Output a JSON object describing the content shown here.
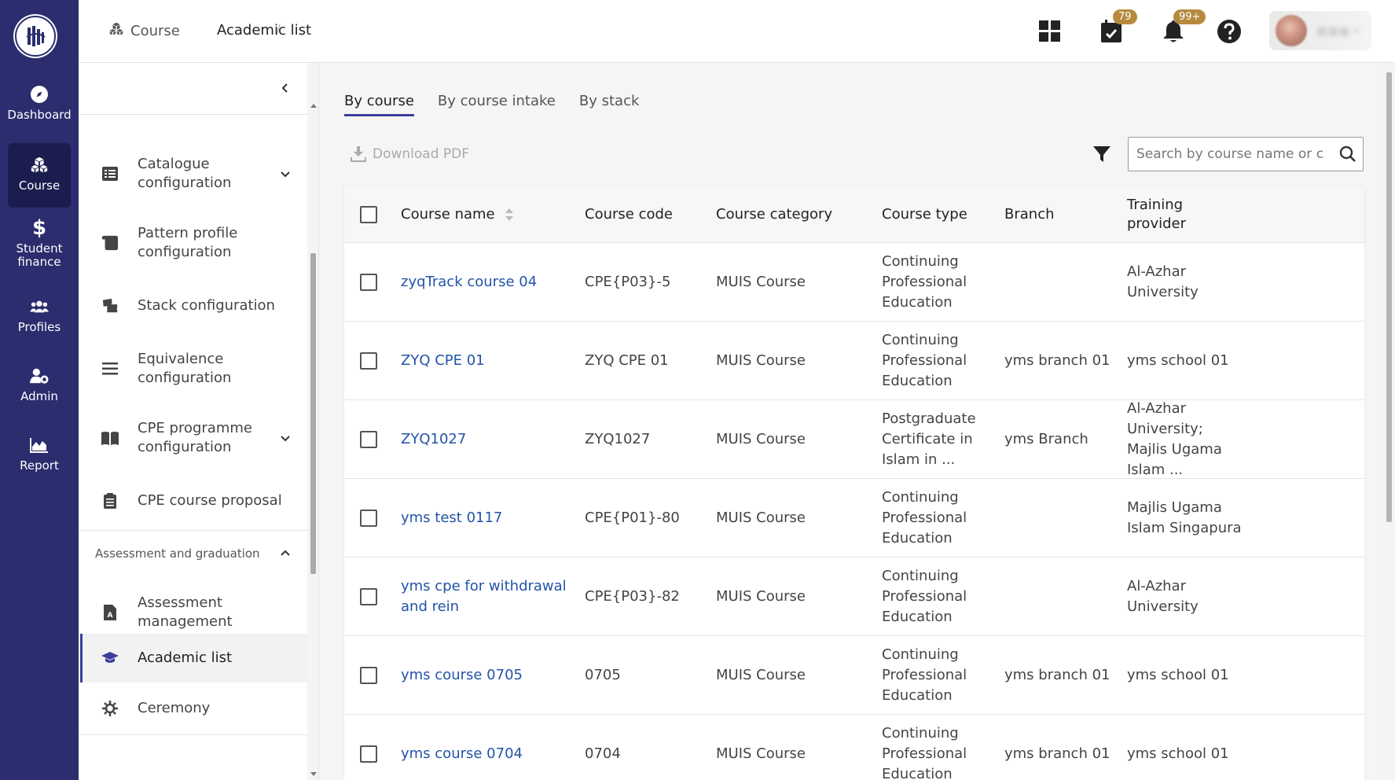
{
  "colors": {
    "nav_bg": "#2b2d6e",
    "link": "#2353a8",
    "badge": "#b58a3e",
    "accent": "#3b3f9a"
  },
  "leftnav": {
    "items": [
      {
        "label": "Dashboard",
        "icon": "compass-icon"
      },
      {
        "label": "Course",
        "icon": "cubes-icon",
        "active": true
      },
      {
        "label": "Student finance",
        "icon": "dollar-icon"
      },
      {
        "label": "Profiles",
        "icon": "users-icon"
      },
      {
        "label": "Admin",
        "icon": "user-gear-icon"
      },
      {
        "label": "Report",
        "icon": "area-chart-icon"
      }
    ]
  },
  "header": {
    "breadcrumb": {
      "parent": "Course",
      "separator": "/",
      "current": "Academic list"
    },
    "calendar_badge": "79",
    "bell_badge": "99+"
  },
  "sidemenu": {
    "items": [
      {
        "label": "Catalogue configuration",
        "icon": "list-alt-icon",
        "expandable": true
      },
      {
        "label": "Pattern profile configuration",
        "icon": "scroll-icon"
      },
      {
        "label": "Stack configuration",
        "icon": "tickets-icon"
      },
      {
        "label": "Equivalence configuration",
        "icon": "bars-icon"
      },
      {
        "label": "CPE programme configuration",
        "icon": "book-open-icon",
        "expandable": true
      },
      {
        "label": "CPE course proposal",
        "icon": "clipboard-icon"
      },
      {
        "label": "Assessment management",
        "icon": "file-a-icon"
      },
      {
        "label": "Academic list",
        "icon": "graduation-cap-icon",
        "active": true
      },
      {
        "label": "Ceremony",
        "icon": "cog-sun-icon"
      }
    ],
    "section_label": "Assessment and graduation"
  },
  "main": {
    "tabs": [
      {
        "label": "By course",
        "active": true
      },
      {
        "label": "By course intake"
      },
      {
        "label": "By stack"
      }
    ],
    "download_label": "Download PDF",
    "search_placeholder": "Search by course name or c...",
    "table": {
      "headers": [
        "Course name",
        "Course code",
        "Course category",
        "Course type",
        "Branch",
        "Training provider"
      ],
      "rows": [
        {
          "name": "zyqTrack course 04",
          "code": "CPE{P03}-5",
          "category": "MUIS Course",
          "type": "Continuing Professional Education",
          "branch": "",
          "provider": "Al-Azhar University"
        },
        {
          "name": "ZYQ CPE 01",
          "code": "ZYQ CPE 01",
          "category": "MUIS Course",
          "type": "Continuing Professional Education",
          "branch": "yms branch 01",
          "provider": "yms school 01"
        },
        {
          "name": "ZYQ1027",
          "code": "ZYQ1027",
          "category": "MUIS Course",
          "type": "Postgraduate Certificate in Islam in ...",
          "branch": "yms Branch",
          "provider": "Al-Azhar University; Majlis Ugama Islam ..."
        },
        {
          "name": "yms test 0117",
          "code": "CPE{P01}-80",
          "category": "MUIS Course",
          "type": "Continuing Professional Education",
          "branch": "",
          "provider": "Majlis Ugama Islam Singapura"
        },
        {
          "name": "yms cpe for withdrawal and rein",
          "code": "CPE{P03}-82",
          "category": "MUIS Course",
          "type": "Continuing Professional Education",
          "branch": "",
          "provider": "Al-Azhar University"
        },
        {
          "name": "yms course 0705",
          "code": "0705",
          "category": "MUIS Course",
          "type": "Continuing Professional Education",
          "branch": "yms branch 01",
          "provider": "yms school 01"
        },
        {
          "name": "yms course 0704",
          "code": "0704",
          "category": "MUIS Course",
          "type": "Continuing Professional Education",
          "branch": "yms branch 01",
          "provider": "yms school 01"
        }
      ]
    }
  }
}
